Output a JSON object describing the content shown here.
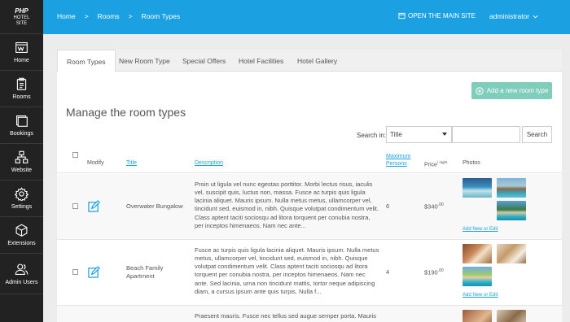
{
  "sidebar": {
    "logo": {
      "line1": "PHP",
      "line2": "HOTEL",
      "line3": "SITE"
    },
    "items": [
      {
        "label": "Home",
        "icon": "home-icon"
      },
      {
        "label": "Rooms",
        "icon": "rooms-icon"
      },
      {
        "label": "Bookings",
        "icon": "bookings-icon"
      },
      {
        "label": "Website",
        "icon": "website-icon"
      },
      {
        "label": "Settings",
        "icon": "settings-icon"
      },
      {
        "label": "Extensions",
        "icon": "extensions-icon"
      },
      {
        "label": "Admin Users",
        "icon": "admin-users-icon"
      }
    ]
  },
  "topbar": {
    "breadcrumbs": [
      "Home",
      "Rooms",
      "Room Types"
    ],
    "separator": ">",
    "open_site": "OPEN THE MAIN SITE",
    "user": "administrator"
  },
  "tabs": [
    "Room Types",
    "New Room Type",
    "Special Offers",
    "Hotel Facilities",
    "Hotel Gallery"
  ],
  "add_button": "Add a new room type",
  "page_title": "Manage the room types",
  "search": {
    "label": "Search in:",
    "selected": "Title",
    "button": "Search"
  },
  "table": {
    "headers": {
      "modify": "Modify",
      "title": "Title",
      "description": "Description",
      "max_persons": "Maximum Persons",
      "price": "Price",
      "price_unit": "/ night",
      "photos": "Photos"
    },
    "add_new_edit": "Add New or Edit",
    "rows": [
      {
        "title": "Overwater Bungalow",
        "description": "Proin ut ligula vel nunc egestas porttitor. Morbi lectus risus, iaculis vel, suscipit quis, luctus non, massa. Fusce ac turpis quis ligula lacinia aliquet. Mauris ipsum. Nulla metus metus, ullamcorper vel, tincidunt sed, euismod in, nibh. Quisque volutpat condimentum velit. Class aptent taciti sociosqu ad litora torquent per conubia nostra, per inceptos himenaeos. Nam nec ante...",
        "persons": "6",
        "price": "$340",
        "cents": ".00"
      },
      {
        "title": "Beach Family Apartment",
        "description": "Fusce ac turpis quis ligula lacinia aliquet. Mauris ipsum. Nulla metus metus, ullamcorper vel, tincidunt sed, euismod in, nibh. Quisque volutpat condimentum velit. Class aptent taciti sociosqu ad litora torquent per conubia nostra, per inceptos himenaeos. Nam nec ante. Sed lacinia, urna non tincidunt mattis, tortor neque adipiscing diam, a cursus ipsum ante quis turpis. Nulla f...",
        "persons": "4",
        "price": "$190",
        "cents": ".00"
      },
      {
        "title": "",
        "description": "Praesent mauris. Fusce nec tellus sed augue semper porta. Mauris",
        "persons": "",
        "price": "",
        "cents": ""
      }
    ]
  },
  "colors": {
    "accent": "#1ba1e2",
    "sidebar": "#222222",
    "add_button": "#7fcdbb"
  }
}
